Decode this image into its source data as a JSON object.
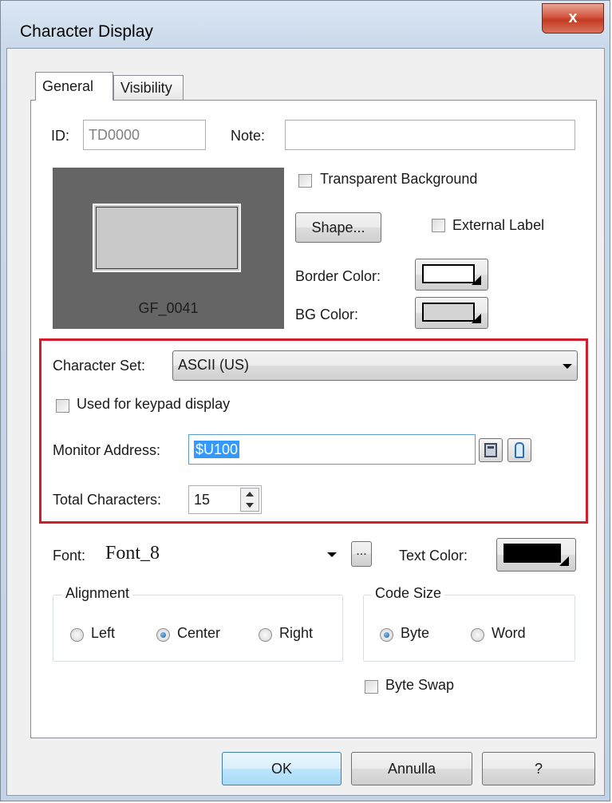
{
  "window": {
    "title": "Character Display",
    "close_glyph": "x"
  },
  "tabs": [
    {
      "label": "General",
      "active": true
    },
    {
      "label": "Visibility",
      "active": false
    }
  ],
  "general": {
    "id_label": "ID:",
    "id_value": "TD0000",
    "note_label": "Note:",
    "note_value": "",
    "preview_caption": "GF_0041",
    "transparent_bg_label": "Transparent Background",
    "transparent_bg_checked": false,
    "shape_button": "Shape...",
    "external_label_label": "External Label",
    "external_label_checked": false,
    "border_color_label": "Border Color:",
    "border_color": "#ffffff",
    "bg_color_label": "BG Color:",
    "bg_color": "#d4d4d4"
  },
  "character": {
    "set_label": "Character Set:",
    "set_value": "ASCII (US)",
    "keypad_label": "Used for keypad display",
    "keypad_checked": false,
    "monitor_label": "Monitor Address:",
    "monitor_value": "$U100",
    "total_label": "Total Characters:",
    "total_value": "15"
  },
  "font": {
    "label": "Font:",
    "value": "Font_8",
    "browse": "...",
    "text_color_label": "Text Color:",
    "text_color": "#000000"
  },
  "alignment": {
    "title": "Alignment",
    "options": [
      "Left",
      "Center",
      "Right"
    ],
    "selected": "Center"
  },
  "code_size": {
    "title": "Code Size",
    "options": [
      "Byte",
      "Word"
    ],
    "selected": "Byte"
  },
  "byte_swap": {
    "label": "Byte Swap",
    "checked": false
  },
  "buttons": {
    "ok": "OK",
    "cancel": "Annulla",
    "help": "?"
  },
  "colors": {
    "highlight": "#d21e2b",
    "preview_bg": "#656565",
    "selection": "#3399ff"
  }
}
